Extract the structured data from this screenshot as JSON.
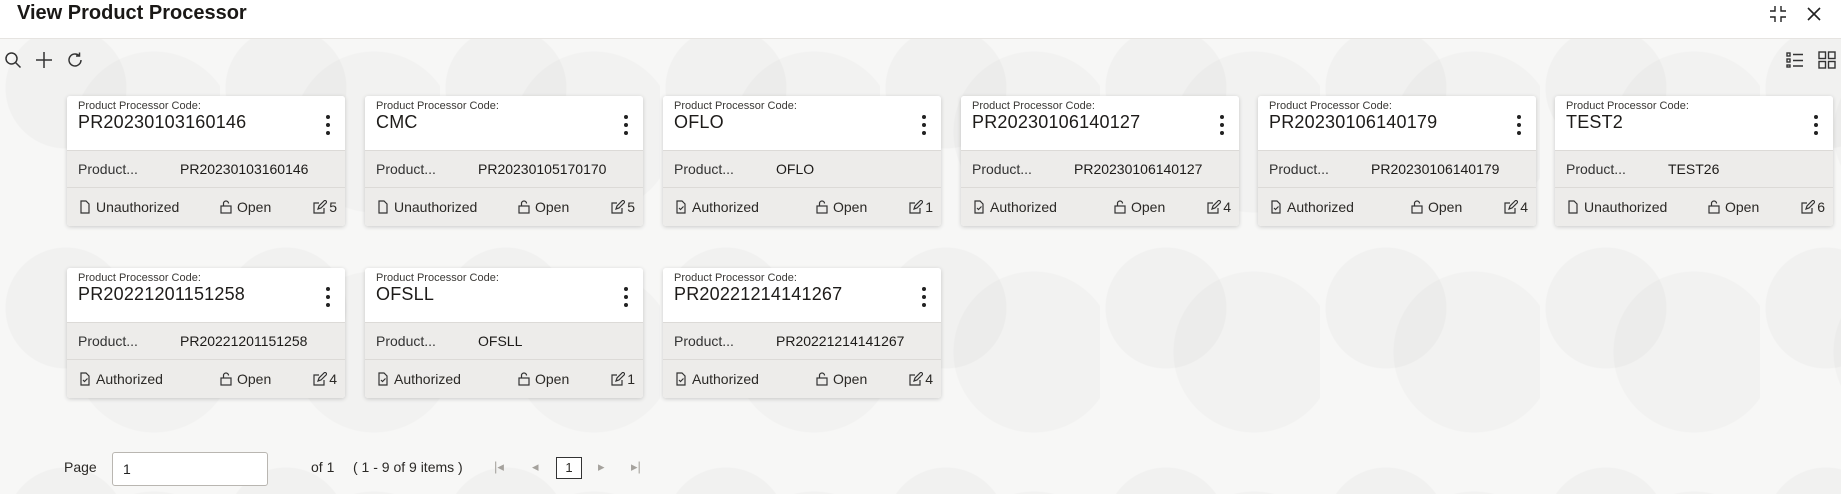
{
  "window": {
    "title": "View Product Processor"
  },
  "toolbar": {
    "search_icon": "search-icon",
    "add_icon": "plus-icon",
    "refresh_icon": "refresh-icon",
    "list_view_icon": "list-view-icon",
    "grid_view_icon": "grid-view-icon"
  },
  "cards": [
    {
      "code_label": "Product Processor Code:",
      "code": "PR20230103160146",
      "name_label": "Product...",
      "name_value": "PR20230103160146",
      "status": "Unauthorized",
      "state": "Open",
      "mods": "5"
    },
    {
      "code_label": "Product Processor Code:",
      "code": "CMC",
      "name_label": "Product...",
      "name_value": "PR20230105170170",
      "status": "Unauthorized",
      "state": "Open",
      "mods": "5"
    },
    {
      "code_label": "Product Processor Code:",
      "code": "OFLO",
      "name_label": "Product...",
      "name_value": "OFLO",
      "status": "Authorized",
      "state": "Open",
      "mods": "1"
    },
    {
      "code_label": "Product Processor Code:",
      "code": "PR20230106140127",
      "name_label": "Product...",
      "name_value": "PR20230106140127",
      "status": "Authorized",
      "state": "Open",
      "mods": "4"
    },
    {
      "code_label": "Product Processor Code:",
      "code": "PR20230106140179",
      "name_label": "Product...",
      "name_value": "PR20230106140179",
      "status": "Authorized",
      "state": "Open",
      "mods": "4"
    },
    {
      "code_label": "Product Processor Code:",
      "code": "TEST2",
      "name_label": "Product...",
      "name_value": "TEST26",
      "status": "Unauthorized",
      "state": "Open",
      "mods": "6"
    },
    {
      "code_label": "Product Processor Code:",
      "code": "PR20221201151258",
      "name_label": "Product...",
      "name_value": "PR20221201151258",
      "status": "Authorized",
      "state": "Open",
      "mods": "4"
    },
    {
      "code_label": "Product Processor Code:",
      "code": "OFSLL",
      "name_label": "Product...",
      "name_value": "OFSLL",
      "status": "Authorized",
      "state": "Open",
      "mods": "1"
    },
    {
      "code_label": "Product Processor Code:",
      "code": "PR20221214141267",
      "name_label": "Product...",
      "name_value": "PR20221214141267",
      "status": "Authorized",
      "state": "Open",
      "mods": "4"
    }
  ],
  "pager": {
    "label": "Page",
    "value": "1",
    "of": "of 1",
    "range": "( 1 - 9 of 9 items )",
    "current": "1"
  }
}
